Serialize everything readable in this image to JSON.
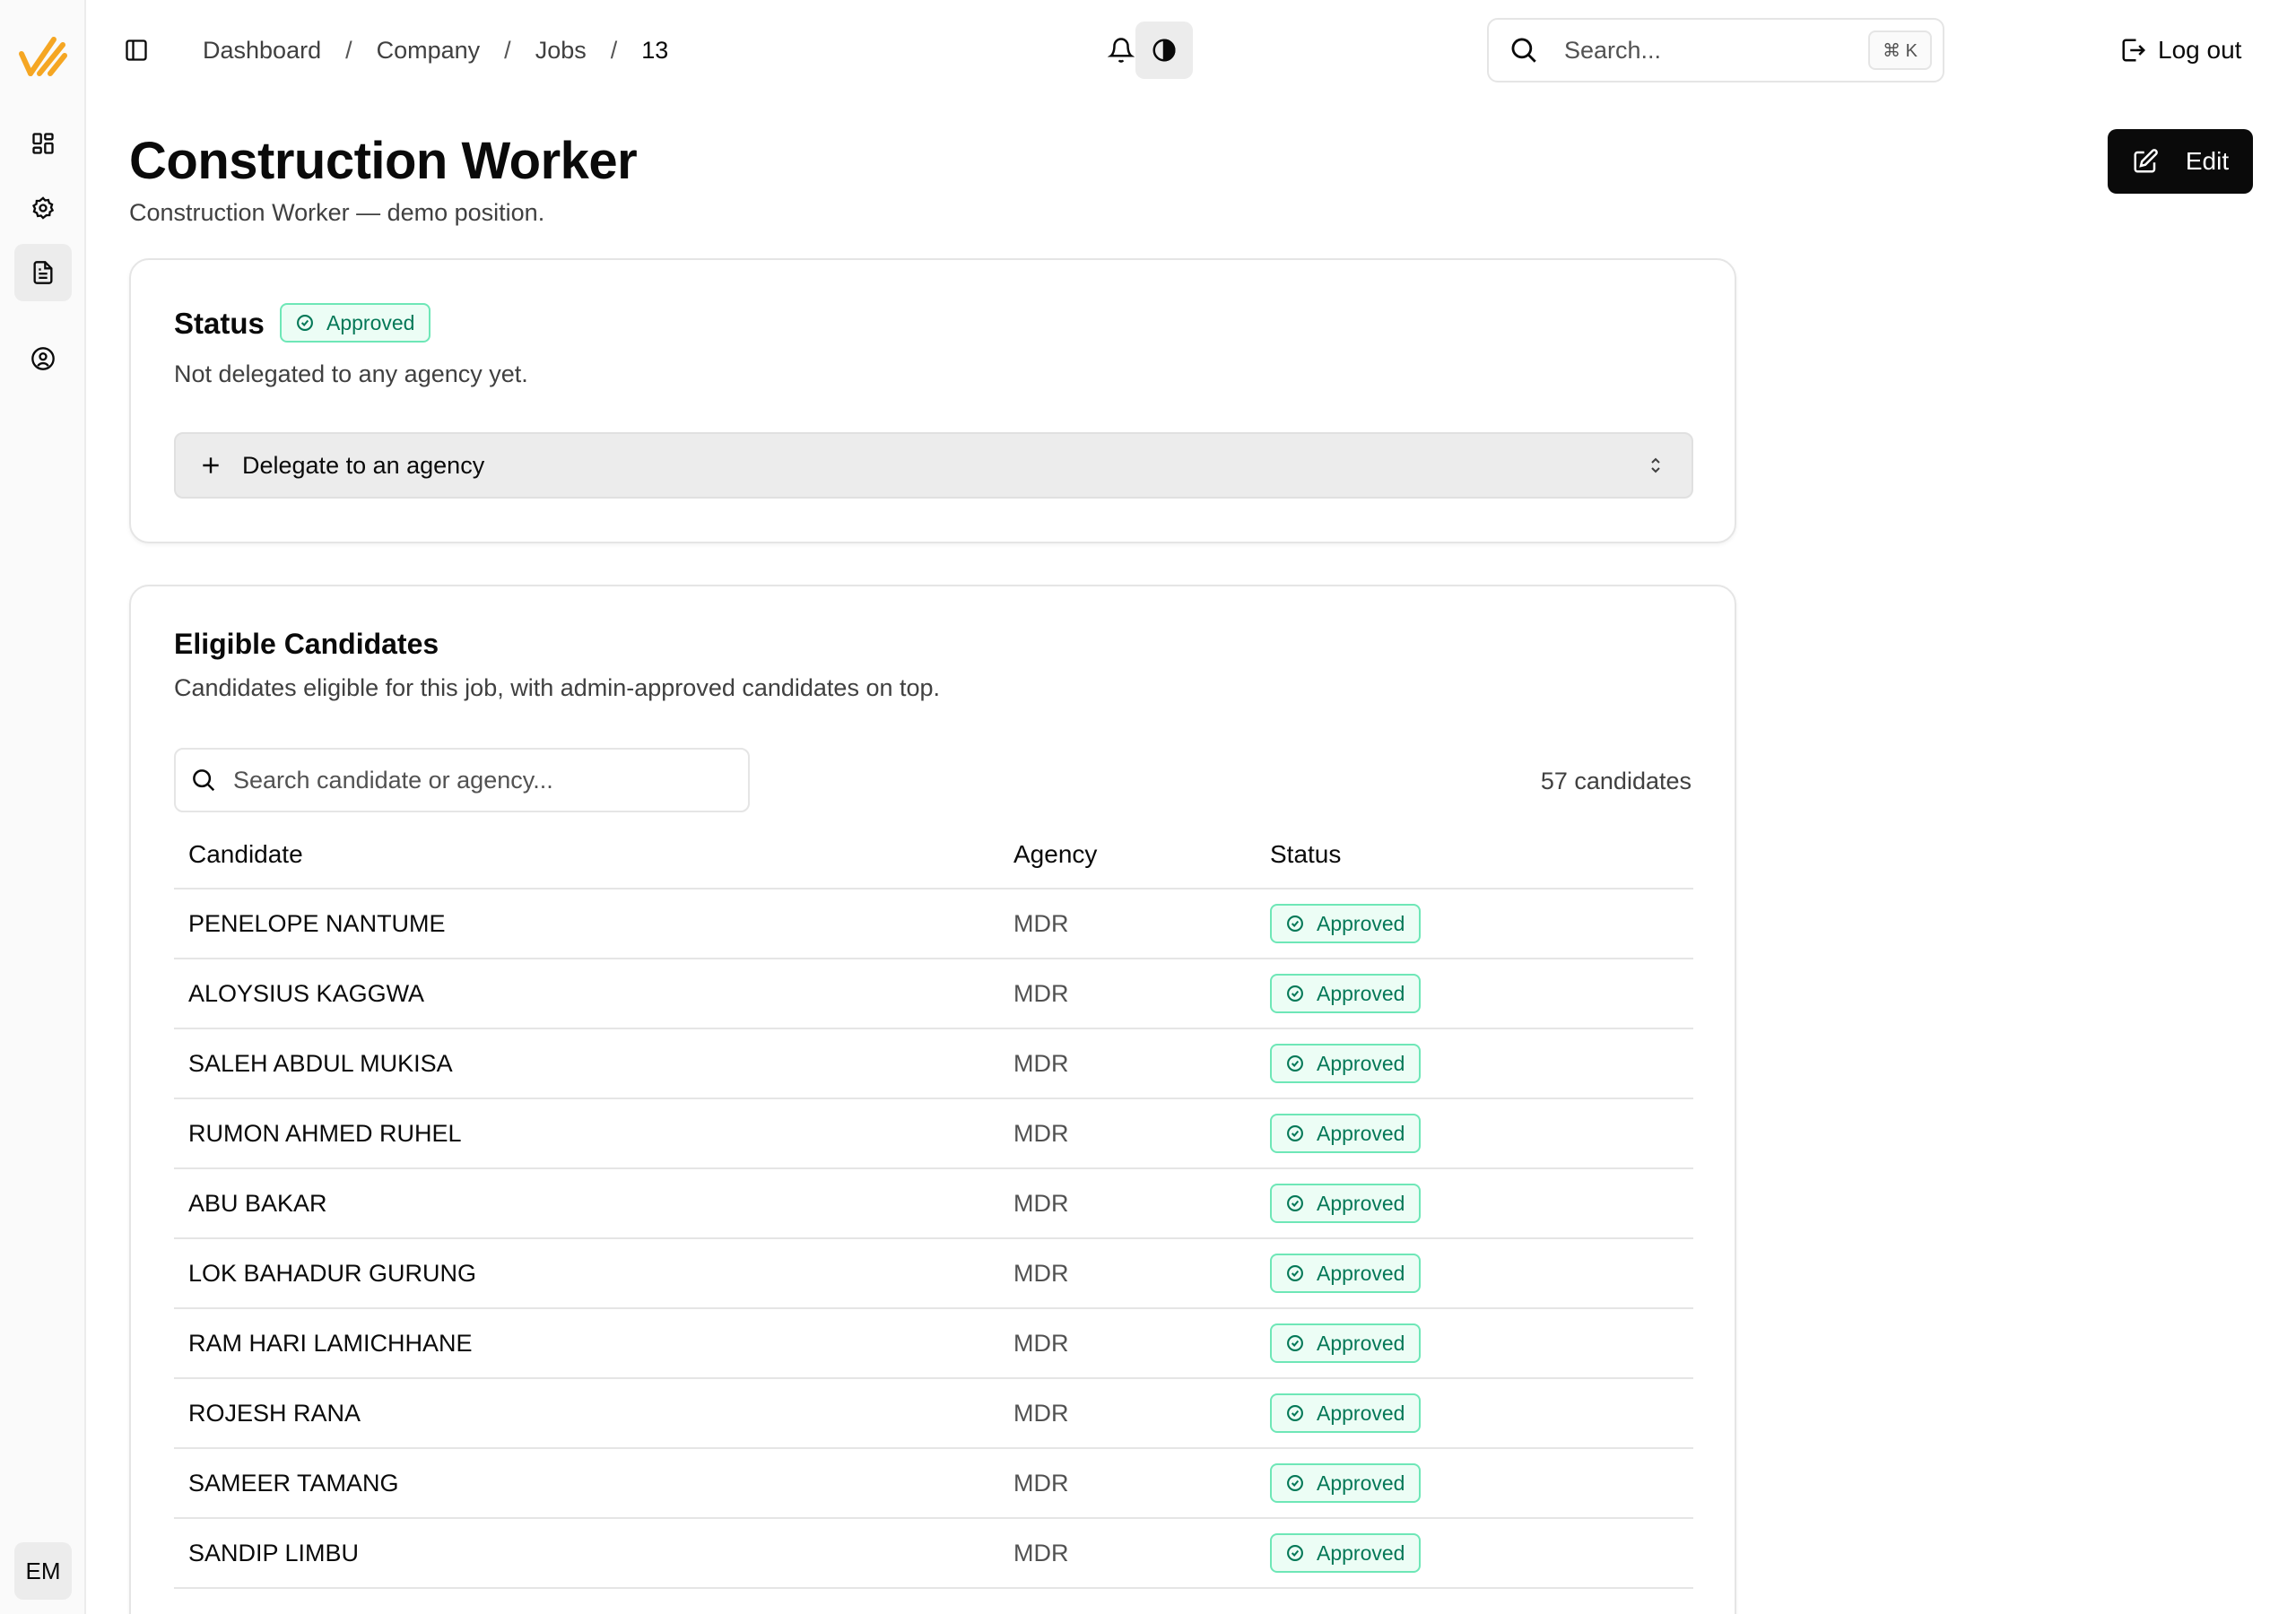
{
  "sidebar": {
    "items": [
      {
        "icon": "dashboard-icon"
      },
      {
        "icon": "gear-icon"
      },
      {
        "icon": "document-icon"
      },
      {
        "icon": "user-circle-icon"
      }
    ],
    "avatar_initials": "EM"
  },
  "header": {
    "breadcrumb": [
      "Dashboard",
      "Company",
      "Jobs",
      "13"
    ],
    "search_placeholder": "Search...",
    "shortcut": "⌘ K",
    "logout_label": "Log out"
  },
  "page": {
    "title": "Construction Worker",
    "subtitle": "Construction Worker — demo position.",
    "edit_label": "Edit"
  },
  "status_card": {
    "title": "Status",
    "badge": "Approved",
    "description": "Not delegated to any agency yet.",
    "delegate_label": "Delegate to an agency"
  },
  "candidates_card": {
    "title": "Eligible Candidates",
    "description": "Candidates eligible for this job, with admin-approved candidates on top.",
    "search_placeholder": "Search candidate or agency...",
    "count_label": "57 candidates",
    "columns": [
      "Candidate",
      "Agency",
      "Status"
    ],
    "rows": [
      {
        "name": "PENELOPE NANTUME",
        "agency": "MDR",
        "status": "Approved"
      },
      {
        "name": "ALOYSIUS KAGGWA",
        "agency": "MDR",
        "status": "Approved"
      },
      {
        "name": "SALEH ABDUL MUKISA",
        "agency": "MDR",
        "status": "Approved"
      },
      {
        "name": "RUMON AHMED RUHEL",
        "agency": "MDR",
        "status": "Approved"
      },
      {
        "name": "ABU BAKAR",
        "agency": "MDR",
        "status": "Approved"
      },
      {
        "name": "LOK BAHADUR GURUNG",
        "agency": "MDR",
        "status": "Approved"
      },
      {
        "name": "RAM HARI LAMICHHANE",
        "agency": "MDR",
        "status": "Approved"
      },
      {
        "name": "ROJESH RANA",
        "agency": "MDR",
        "status": "Approved"
      },
      {
        "name": "SAMEER TAMANG",
        "agency": "MDR",
        "status": "Approved"
      },
      {
        "name": "SANDIP LIMBU",
        "agency": "MDR",
        "status": "Approved"
      }
    ]
  },
  "colors": {
    "brand": "#f5a623",
    "approved_text": "#047857",
    "approved_border": "#6ee7b7",
    "approved_bg": "#ecfdf5"
  }
}
